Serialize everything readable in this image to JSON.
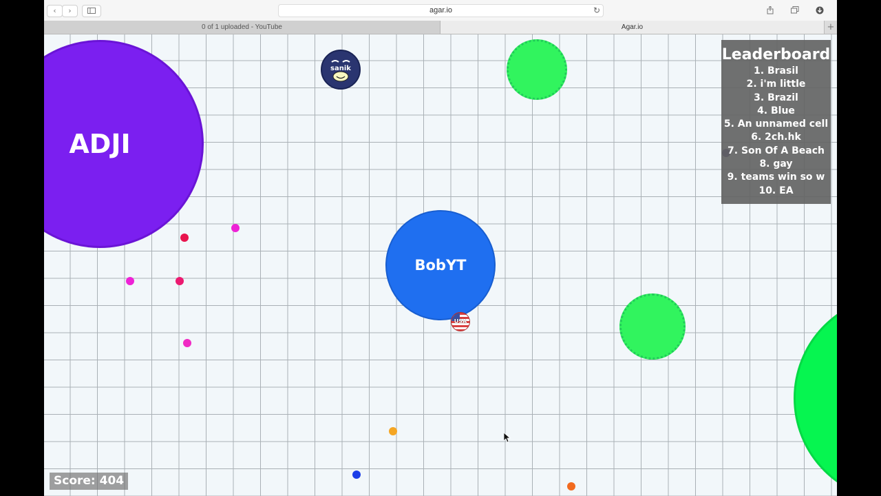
{
  "browser": {
    "url": "agar.io",
    "tabs": [
      {
        "label": "0 of 1 uploaded - YouTube",
        "active": false
      },
      {
        "label": "Agar.io",
        "active": true
      }
    ],
    "icons": {
      "back": "chevron-left-icon",
      "forward": "chevron-right-icon",
      "sidebar": "sidebar-icon",
      "reload": "reload-icon",
      "share": "share-icon",
      "tabs": "tabs-overview-icon",
      "downloads": "download-icon",
      "new_tab": "plus-icon"
    }
  },
  "game": {
    "cells": {
      "adji": {
        "name": "ADJI",
        "color": "#7b1ff0"
      },
      "bobyt": {
        "name": "BobYT",
        "color": "#1f6ff0"
      },
      "sanik": {
        "name": "sanik",
        "color": "#2a3570"
      },
      "usa": {
        "name": "USA",
        "color": "#d94040"
      }
    },
    "virus_color": "#31f45e",
    "big_green_color": "#06f550",
    "leaderboard": {
      "title": "Leaderboard",
      "entries": [
        "1. Brasil",
        "2. i'm little",
        "3. Brazil",
        "4. Blue",
        "5. An unnamed cell",
        "6. 2ch.hk",
        "7. Son Of A Beach",
        "8. gay",
        "9. teams win so w",
        "10. EA"
      ]
    },
    "score": "Score: 404"
  }
}
